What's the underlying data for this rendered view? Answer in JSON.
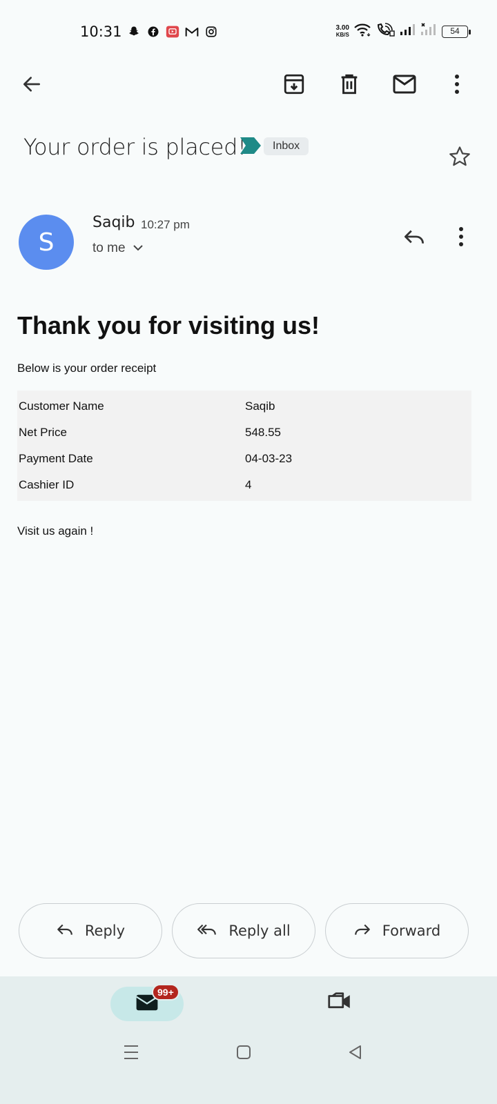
{
  "status_bar": {
    "time": "10:31",
    "net_speed_value": "3.00",
    "net_speed_unit": "KB/S",
    "battery": "54",
    "left_icons": [
      "snapchat-icon",
      "facebook-icon",
      "youtube-icon",
      "gmail-icon",
      "instagram-icon"
    ]
  },
  "toolbar": {
    "back_icon": "arrow-left-icon",
    "archive_icon": "archive-icon",
    "delete_icon": "trash-icon",
    "mark_unread_icon": "mail-icon",
    "more_icon": "more-vert-icon"
  },
  "email": {
    "subject": "Your order is placed!",
    "label": "Inbox",
    "sender_initial": "S",
    "sender_name": "Saqib",
    "time": "10:27 pm",
    "recipient": "to me"
  },
  "body": {
    "heading": "Thank you for visiting us!",
    "intro": "Below is your order receipt",
    "receipt": [
      {
        "key": "Customer Name",
        "value": "Saqib"
      },
      {
        "key": "Net Price",
        "value": "548.55"
      },
      {
        "key": "Payment Date",
        "value": "04-03-23"
      },
      {
        "key": "Cashier ID",
        "value": "4"
      }
    ],
    "closing": "Visit us again !"
  },
  "actions": {
    "reply": "Reply",
    "reply_all": "Reply all",
    "forward": "Forward"
  },
  "bottom_nav": {
    "mail_badge": "99+"
  },
  "colors": {
    "avatar": "#5b8def",
    "important_marker": "#1f8a87",
    "badge": "#b3261e",
    "nav_background": "#e5eeee"
  }
}
